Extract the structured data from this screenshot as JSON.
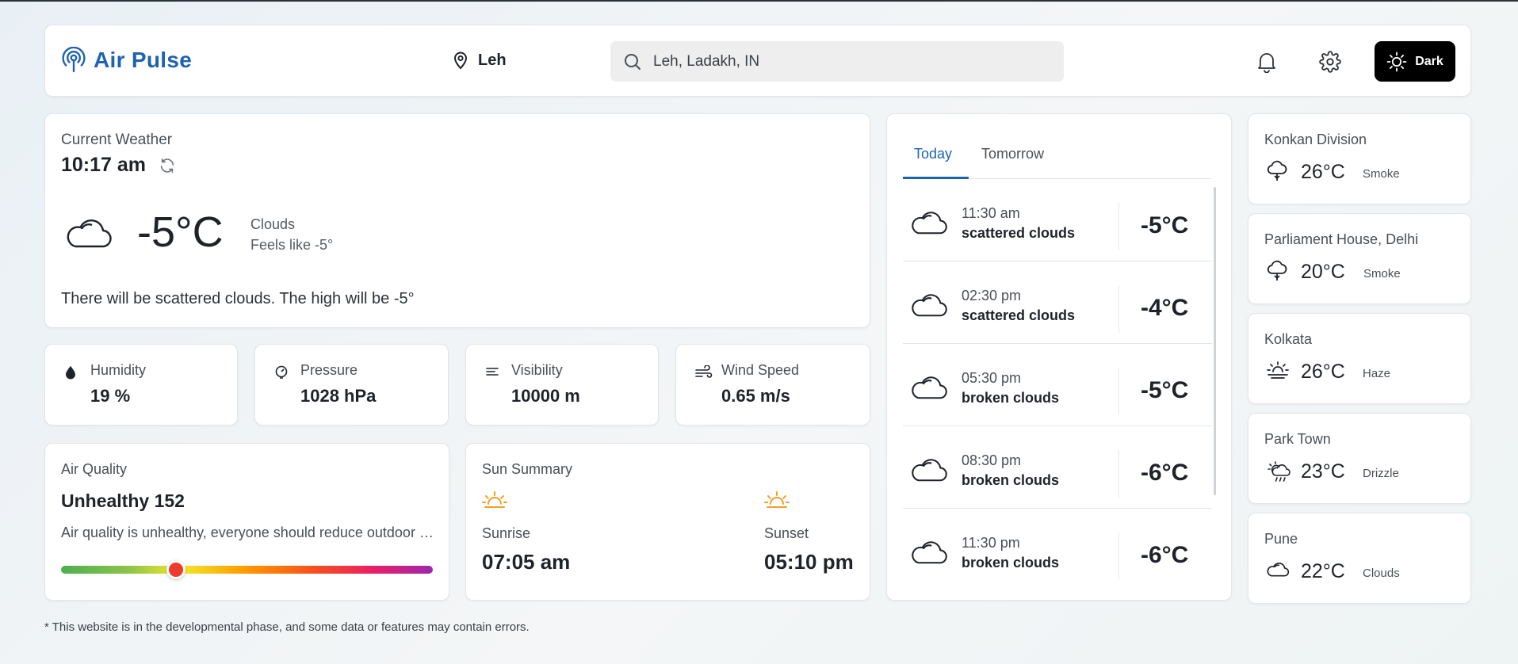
{
  "app": {
    "name": "Air Pulse",
    "brand_color": "#1e63b0"
  },
  "header": {
    "location": "Leh",
    "search": {
      "value": "Leh, Ladakh, IN",
      "placeholder": ""
    },
    "theme_button": "Dark"
  },
  "current": {
    "title": "Current Weather",
    "time": "10:17 am",
    "temp": "-5°C",
    "condition": "Clouds",
    "feels_like": "Feels like -5°",
    "description": "There will be scattered clouds. The high will be -5°"
  },
  "metrics": [
    {
      "label": "Humidity",
      "value": "19 %",
      "icon": "humidity-icon"
    },
    {
      "label": "Pressure",
      "value": "1028 hPa",
      "icon": "pressure-icon"
    },
    {
      "label": "Visibility",
      "value": "10000 m",
      "icon": "visibility-icon"
    },
    {
      "label": "Wind Speed",
      "value": "0.65 m/s",
      "icon": "wind-icon"
    }
  ],
  "air_quality": {
    "title": "Air Quality",
    "status": "Unhealthy 152",
    "description": "Air quality is unhealthy, everyone should reduce outdoor activities.",
    "level_fraction": 0.31
  },
  "sun": {
    "title": "Sun Summary",
    "sunrise_label": "Sunrise",
    "sunrise": "07:05 am",
    "sunset_label": "Sunset",
    "sunset": "05:10 pm",
    "icon_color": "#f2a025"
  },
  "forecast": {
    "tabs": [
      "Today",
      "Tomorrow"
    ],
    "active_tab": "Today",
    "items": [
      {
        "time": "11:30 am",
        "desc": "scattered clouds",
        "temp": "-5°C"
      },
      {
        "time": "02:30 pm",
        "desc": "scattered clouds",
        "temp": "-4°C"
      },
      {
        "time": "05:30 pm",
        "desc": "broken clouds",
        "temp": "-5°C"
      },
      {
        "time": "08:30 pm",
        "desc": "broken clouds",
        "temp": "-6°C"
      },
      {
        "time": "11:30 pm",
        "desc": "broken clouds",
        "temp": "-6°C"
      }
    ]
  },
  "cities": [
    {
      "name": "Konkan Division",
      "temp": "26°C",
      "condition": "Smoke",
      "icon": "smoke-icon"
    },
    {
      "name": "Parliament House, Delhi",
      "temp": "20°C",
      "condition": "Smoke",
      "icon": "smoke-icon"
    },
    {
      "name": "Kolkata",
      "temp": "26°C",
      "condition": "Haze",
      "icon": "haze-icon"
    },
    {
      "name": "Park Town",
      "temp": "23°C",
      "condition": "Drizzle",
      "icon": "drizzle-icon"
    },
    {
      "name": "Pune",
      "temp": "22°C",
      "condition": "Clouds",
      "icon": "cloud-icon"
    }
  ],
  "footnote": "* This website is in the developmental phase, and some data or features may contain errors."
}
